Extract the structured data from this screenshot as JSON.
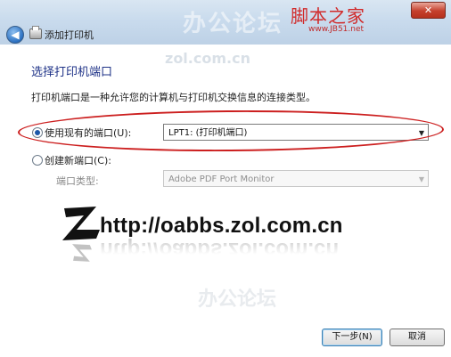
{
  "window": {
    "title": "添加打印机",
    "close_glyph": "✕"
  },
  "watermarks": {
    "brand_cn": "脚本之家",
    "brand_url": "www.JB51.net",
    "site_faint": "zol.com.cn"
  },
  "page": {
    "heading": "选择打印机端口",
    "description": "打印机端口是一种允许您的计算机与打印机交换信息的连接类型。"
  },
  "options": {
    "use_existing": {
      "label": "使用现有的端口(U):",
      "selected": true,
      "value": "LPT1: (打印机端口)"
    },
    "create_new": {
      "label": "创建新端口(C):",
      "selected": false,
      "port_type_label": "端口类型:",
      "port_type_value": "Adobe PDF Port Monitor"
    }
  },
  "overlay": {
    "url": "http://oabbs.zol.com.cn",
    "faint_logo": "办公论坛"
  },
  "buttons": {
    "next": "下一步(N)",
    "cancel": "取消"
  },
  "colors": {
    "heading": "#1e3287",
    "annotation_oval": "#cc1f1f",
    "logo_red": "#d12a2a"
  }
}
